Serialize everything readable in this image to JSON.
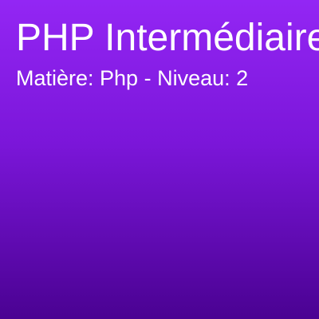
{
  "card": {
    "title": "PHP Intermédiaire",
    "subtitle": "Matière: Php - Niveau: 2"
  },
  "colors": {
    "gradient_top": "#9326f4",
    "gradient_bottom": "#4a0292",
    "text": "#ffffff"
  }
}
